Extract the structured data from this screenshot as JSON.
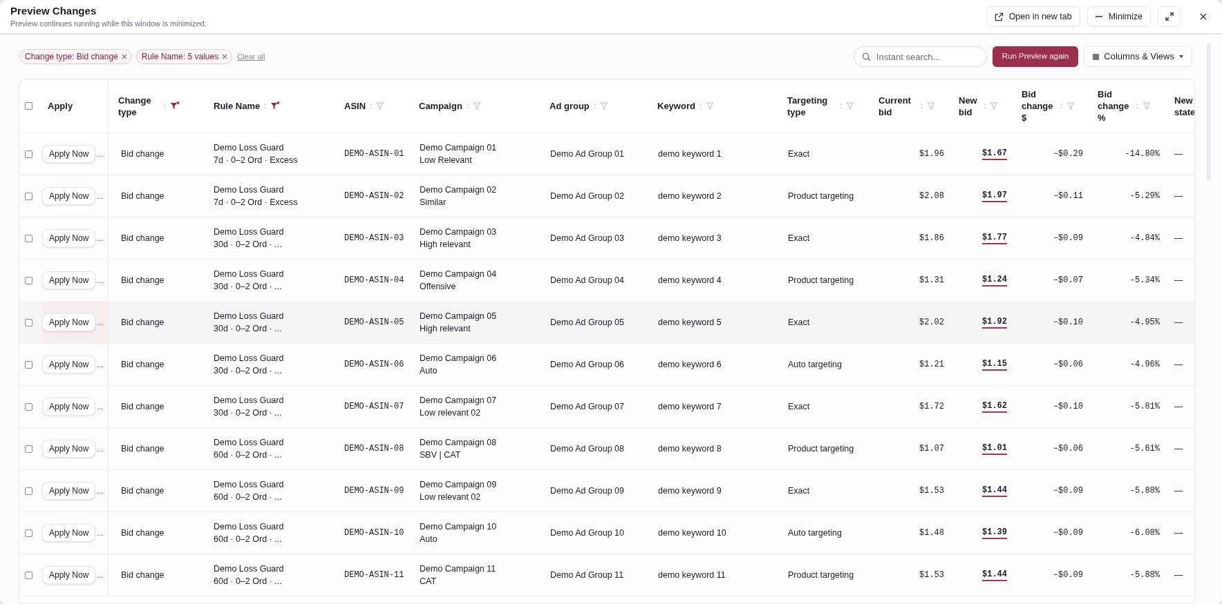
{
  "window": {
    "title": "Preview Changes",
    "subtitle": "Preview continues running while this window is minimized.",
    "buttons": [
      {
        "kind": "open",
        "label": "Open in new tab"
      },
      {
        "kind": "minimize",
        "label": "Minimize"
      },
      {
        "kind": "expand"
      },
      {
        "kind": "close"
      }
    ]
  },
  "filters": {
    "chips": [
      {
        "label": "Change type: Bid change"
      },
      {
        "label": "Rule Name: 5 values"
      }
    ],
    "clear_link": "Clear all"
  },
  "search": {
    "placeholder": "Instant search..."
  },
  "run_button": "Run Preview again",
  "columns_button": "Columns & Views",
  "table": {
    "select_all_checked": false,
    "columns": [
      {
        "label": "Apply",
        "kind": "plain"
      },
      {
        "label": "Change type",
        "kind": "filter",
        "filter_active": true
      },
      {
        "label": "Rule Name",
        "kind": "filter",
        "filter_active": true
      },
      {
        "label": "ASIN",
        "kind": "filter",
        "filter_active": false
      },
      {
        "label": "Campaign",
        "kind": "filter",
        "filter_active": false
      },
      {
        "label": "Ad group",
        "kind": "filter",
        "filter_active": false
      },
      {
        "label": "Keyword",
        "kind": "filter",
        "filter_active": false
      },
      {
        "label": "Targeting type",
        "kind": "filter",
        "filter_active": false
      },
      {
        "label": "Current bid",
        "kind": "filter",
        "filter_active": false
      },
      {
        "label": "New bid",
        "kind": "filter",
        "filter_active": false
      },
      {
        "label": "Bid change $",
        "kind": "filter",
        "filter_active": false
      },
      {
        "label": "Bid change %",
        "kind": "filter",
        "filter_active": false
      },
      {
        "label": "New state",
        "kind": "plain"
      }
    ],
    "rows": [
      {
        "checked": false,
        "highlighted": false,
        "apply": "Apply Now",
        "apply_more": "...",
        "change_type": "Bid change",
        "rule": "Demo Loss Guard",
        "rule_detail": "7d · 0–2 Ord · Excess",
        "asin": "DEMO-ASIN-01",
        "campaign": "Demo Campaign 01",
        "campaign_detail": "Low Relevant",
        "ad_group": "Demo Ad Group 01",
        "keyword": "demo keyword 1",
        "targeting": "Exact",
        "current_bid": "$1.96",
        "new_bid": "$1.67",
        "change_usd": "−$0.29",
        "change_pct": "-14.80%",
        "new_state": "—"
      },
      {
        "checked": false,
        "highlighted": false,
        "apply": "Apply Now",
        "apply_more": "...",
        "change_type": "Bid change",
        "rule": "Demo Loss Guard",
        "rule_detail": "7d · 0–2 Ord · Excess",
        "asin": "DEMO-ASIN-02",
        "campaign": "Demo Campaign 02",
        "campaign_detail": "Similar",
        "ad_group": "Demo Ad Group 02",
        "keyword": "demo keyword 2",
        "targeting": "Product targeting",
        "current_bid": "$2.08",
        "new_bid": "$1.97",
        "change_usd": "−$0.11",
        "change_pct": "-5.29%",
        "new_state": "—"
      },
      {
        "checked": false,
        "highlighted": false,
        "apply": "Apply Now",
        "apply_more": "...",
        "change_type": "Bid change",
        "rule": "Demo Loss Guard",
        "rule_detail": "30d · 0–2 Ord · ...",
        "asin": "DEMO-ASIN-03",
        "campaign": "Demo Campaign 03",
        "campaign_detail": "High relevant",
        "ad_group": "Demo Ad Group 03",
        "keyword": "demo keyword 3",
        "targeting": "Exact",
        "current_bid": "$1.86",
        "new_bid": "$1.77",
        "change_usd": "−$0.09",
        "change_pct": "-4.84%",
        "new_state": "—"
      },
      {
        "checked": false,
        "highlighted": false,
        "apply": "Apply Now",
        "apply_more": "...",
        "change_type": "Bid change",
        "rule": "Demo Loss Guard",
        "rule_detail": "30d · 0–2 Ord · ...",
        "asin": "DEMO-ASIN-04",
        "campaign": "Demo Campaign 04",
        "campaign_detail": "Offensive",
        "ad_group": "Demo Ad Group 04",
        "keyword": "demo keyword 4",
        "targeting": "Product targeting",
        "current_bid": "$1.31",
        "new_bid": "$1.24",
        "change_usd": "−$0.07",
        "change_pct": "-5.34%",
        "new_state": "—"
      },
      {
        "checked": false,
        "highlighted": true,
        "apply": "Apply Now",
        "apply_more": "...",
        "change_type": "Bid change",
        "rule": "Demo Loss Guard",
        "rule_detail": "30d · 0–2 Ord · ...",
        "asin": "DEMO-ASIN-05",
        "campaign": "Demo Campaign 05",
        "campaign_detail": "High relevant",
        "ad_group": "Demo Ad Group 05",
        "keyword": "demo keyword 5",
        "targeting": "Exact",
        "current_bid": "$2.02",
        "new_bid": "$1.92",
        "change_usd": "−$0.10",
        "change_pct": "-4.95%",
        "new_state": "—"
      },
      {
        "checked": false,
        "highlighted": false,
        "apply": "Apply Now",
        "apply_more": "...",
        "change_type": "Bid change",
        "rule": "Demo Loss Guard",
        "rule_detail": "30d · 0–2 Ord · ...",
        "asin": "DEMO-ASIN-06",
        "campaign": "Demo Campaign 06",
        "campaign_detail": "Auto",
        "ad_group": "Demo Ad Group 06",
        "keyword": "demo keyword 6",
        "targeting": "Auto targeting",
        "current_bid": "$1.21",
        "new_bid": "$1.15",
        "change_usd": "−$0.06",
        "change_pct": "-4.96%",
        "new_state": "—"
      },
      {
        "checked": false,
        "highlighted": false,
        "apply": "Apply Now",
        "apply_more": "...",
        "change_type": "Bid change",
        "rule": "Demo Loss Guard",
        "rule_detail": "30d · 0–2 Ord · ...",
        "asin": "DEMO-ASIN-07",
        "campaign": "Demo Campaign 07",
        "campaign_detail": "Low relevant 02",
        "ad_group": "Demo Ad Group 07",
        "keyword": "demo keyword 7",
        "targeting": "Exact",
        "current_bid": "$1.72",
        "new_bid": "$1.62",
        "change_usd": "−$0.10",
        "change_pct": "-5.81%",
        "new_state": "—"
      },
      {
        "checked": false,
        "highlighted": false,
        "apply": "Apply Now",
        "apply_more": "...",
        "change_type": "Bid change",
        "rule": "Demo Loss Guard",
        "rule_detail": "60d · 0–2 Ord · ...",
        "asin": "DEMO-ASIN-08",
        "campaign": "Demo Campaign 08",
        "campaign_detail": "SBV | CAT",
        "ad_group": "Demo Ad Group 08",
        "keyword": "demo keyword 8",
        "targeting": "Product targeting",
        "current_bid": "$1.07",
        "new_bid": "$1.01",
        "change_usd": "−$0.06",
        "change_pct": "-5.61%",
        "new_state": "—"
      },
      {
        "checked": false,
        "highlighted": false,
        "apply": "Apply Now",
        "apply_more": "...",
        "change_type": "Bid change",
        "rule": "Demo Loss Guard",
        "rule_detail": "60d · 0–2 Ord · ...",
        "asin": "DEMO-ASIN-09",
        "campaign": "Demo Campaign 09",
        "campaign_detail": "Low relevant 02",
        "ad_group": "Demo Ad Group 09",
        "keyword": "demo keyword 9",
        "targeting": "Exact",
        "current_bid": "$1.53",
        "new_bid": "$1.44",
        "change_usd": "−$0.09",
        "change_pct": "-5.88%",
        "new_state": "—"
      },
      {
        "checked": false,
        "highlighted": false,
        "apply": "Apply Now",
        "apply_more": "...",
        "change_type": "Bid change",
        "rule": "Demo Loss Guard",
        "rule_detail": "60d · 0–2 Ord · ...",
        "asin": "DEMO-ASIN-10",
        "campaign": "Demo Campaign 10",
        "campaign_detail": "Auto",
        "ad_group": "Demo Ad Group 10",
        "keyword": "demo keyword 10",
        "targeting": "Auto targeting",
        "current_bid": "$1.48",
        "new_bid": "$1.39",
        "change_usd": "−$0.09",
        "change_pct": "-6.08%",
        "new_state": "—"
      },
      {
        "checked": false,
        "highlighted": false,
        "apply": "Apply Now",
        "apply_more": "...",
        "change_type": "Bid change",
        "rule": "Demo Loss Guard",
        "rule_detail": "60d · 0–2 Ord · ...",
        "asin": "DEMO-ASIN-11",
        "campaign": "Demo Campaign 11",
        "campaign_detail": "CAT",
        "ad_group": "Demo Ad Group 11",
        "keyword": "demo keyword 11",
        "targeting": "Product targeting",
        "current_bid": "$1.53",
        "new_bid": "$1.44",
        "change_usd": "−$0.09",
        "change_pct": "-5.88%",
        "new_state": "—"
      }
    ]
  }
}
